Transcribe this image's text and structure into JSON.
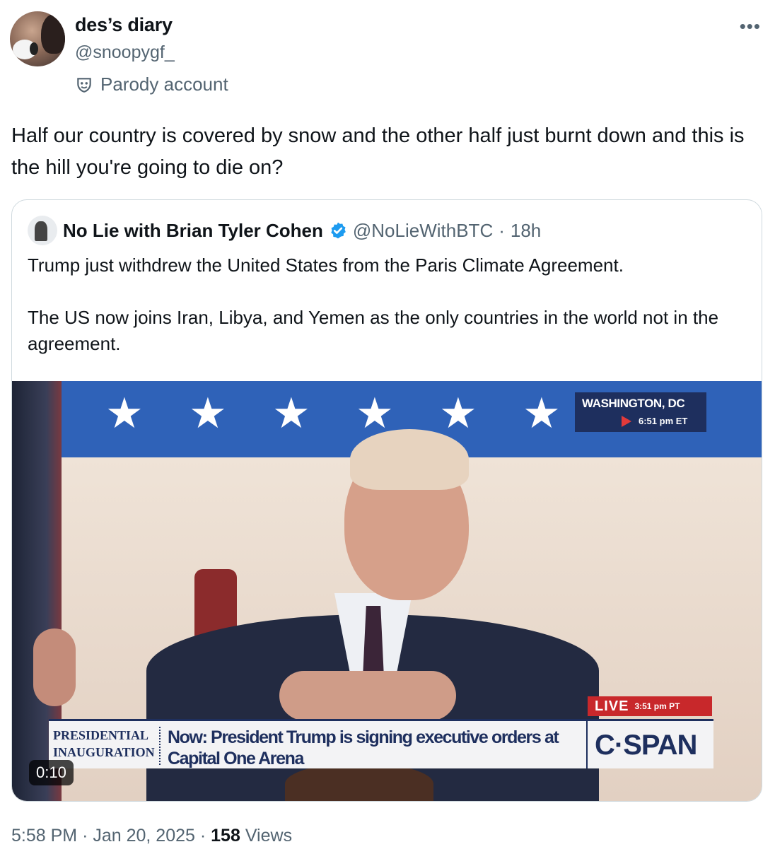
{
  "author": {
    "display_name": "des’s diary",
    "handle": "@snoopygf_",
    "label": "Parody account",
    "label_icon": "parody-mask-icon"
  },
  "more_menu_icon": "ellipsis-icon",
  "tweet": {
    "text": "Half our country is covered by snow and the other half just burnt down and this is the hill you're going to die on?"
  },
  "quoted_tweet": {
    "display_name": "No Lie with Brian Tyler Cohen",
    "verified": true,
    "verified_color": "#1d9bf0",
    "handle": "@NoLieWithBTC",
    "separator": "·",
    "time": "18h",
    "paragraphs": [
      "Trump just withdrew the United States from the Paris Climate Agreement.",
      "The US now joins Iran, Libya, and Yemen as the only countries in the world not in the agreement."
    ],
    "video": {
      "duration": "0:10",
      "location": "WASHINGTON, DC",
      "location_time": "6:51 pm ET",
      "live_label": "LIVE",
      "live_time": "3:51 pm PT",
      "brand_top": "PRESIDENTIAL",
      "brand_bottom": "INAUGURATION",
      "caption": "Now: President Trump is signing executive orders at Capital One Arena",
      "network": "C·SPAN",
      "banner_color": "#2f62b8"
    }
  },
  "meta": {
    "time": "5:58 PM",
    "separator": "·",
    "date": "Jan 20, 2025",
    "views_count": "158",
    "views_label": "Views"
  }
}
